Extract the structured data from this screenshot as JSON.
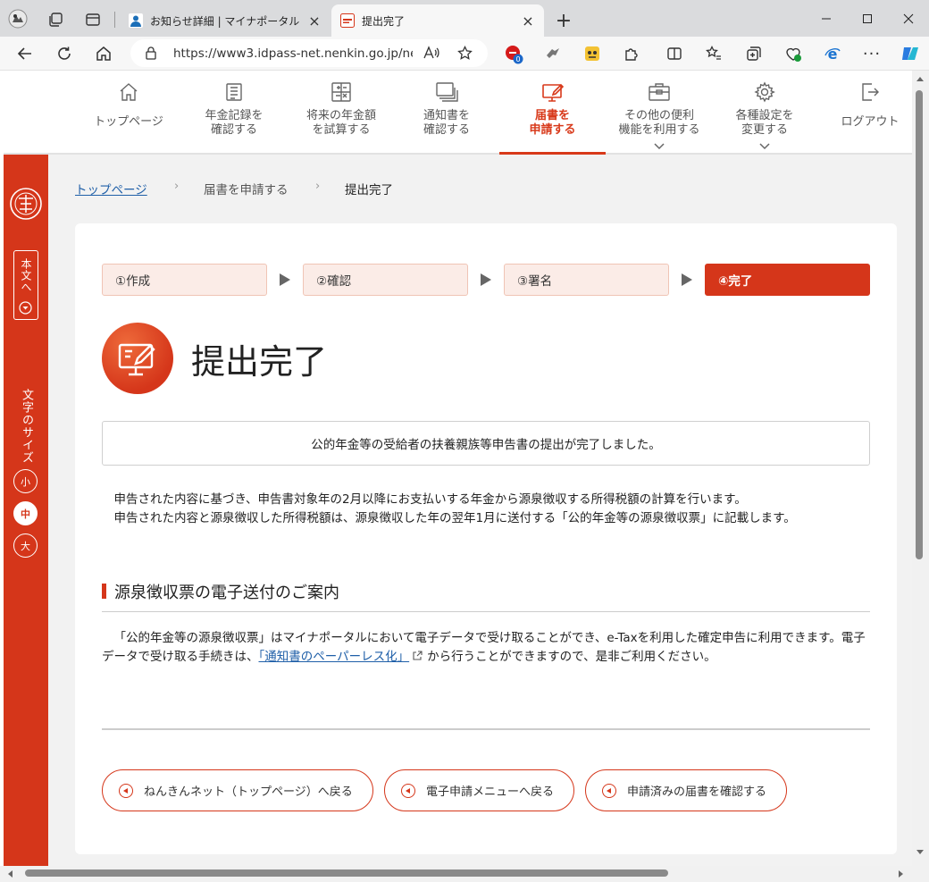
{
  "browser": {
    "tabs": [
      {
        "title": "お知らせ詳細 | マイナポータル",
        "active": false
      },
      {
        "title": "提出完了",
        "active": true
      }
    ],
    "new_tab_label": "+",
    "url": "https://www3.idpass-net.nenkin.go.jp/ne...",
    "extension_badge": "0"
  },
  "nav": {
    "items": [
      {
        "label": "トップページ",
        "icon": "home-icon"
      },
      {
        "label": "年金記録を\n確認する",
        "icon": "record-icon"
      },
      {
        "label": "将来の年金額\nを試算する",
        "icon": "calculator-icon"
      },
      {
        "label": "通知書を\n確認する",
        "icon": "documents-icon"
      },
      {
        "label": "届書を\n申請する",
        "icon": "submit-form-icon",
        "active": true
      },
      {
        "label": "その他の便利\n機能を利用する",
        "icon": "toolbox-icon",
        "dropdown": true
      },
      {
        "label": "各種設定を\n変更する",
        "icon": "gear-icon",
        "dropdown": true
      },
      {
        "label": "ログアウト",
        "icon": "logout-icon"
      }
    ]
  },
  "sidebar": {
    "skip_label": "本文へ",
    "font_size_label": "文字のサイズ",
    "sizes": [
      "小",
      "中",
      "大"
    ],
    "selected_size": "中"
  },
  "breadcrumb": {
    "home": "トップページ",
    "middle": "届書を申請する",
    "current": "提出完了"
  },
  "steps": [
    "①作成",
    "②確認",
    "③署名",
    "④完了"
  ],
  "active_step": 3,
  "page_title": "提出完了",
  "message": "公的年金等の受給者の扶養親族等申告書の提出が完了しました。",
  "paragraphs": [
    "申告された内容に基づき、申告書対象年の2月以降にお支払いする年金から源泉徴収する所得税額の計算を行います。",
    "申告された内容と源泉徴収した所得税額は、源泉徴収した年の翌年1月に送付する「公的年金等の源泉徴収票」に記載します。"
  ],
  "section": {
    "heading": "源泉徴収票の電子送付のご案内",
    "text_before": "「公的年金等の源泉徴収票」はマイナポータルにおいて電子データで受け取ることができ、e-Taxを利用した確定申告に利用できます。電子データで受け取る手続きは、",
    "link_text": "「通知書のペーパーレス化」",
    "text_after": "から行うことができますので、是非ご利用ください。"
  },
  "buttons": [
    "ねんきんネット（トップページ）へ戻る",
    "電子申請メニューへ戻る",
    "申請済みの届書を確認する"
  ],
  "colors": {
    "accent": "#d5361a",
    "step_inactive_bg": "#fbece7",
    "link": "#1f5fa8"
  }
}
